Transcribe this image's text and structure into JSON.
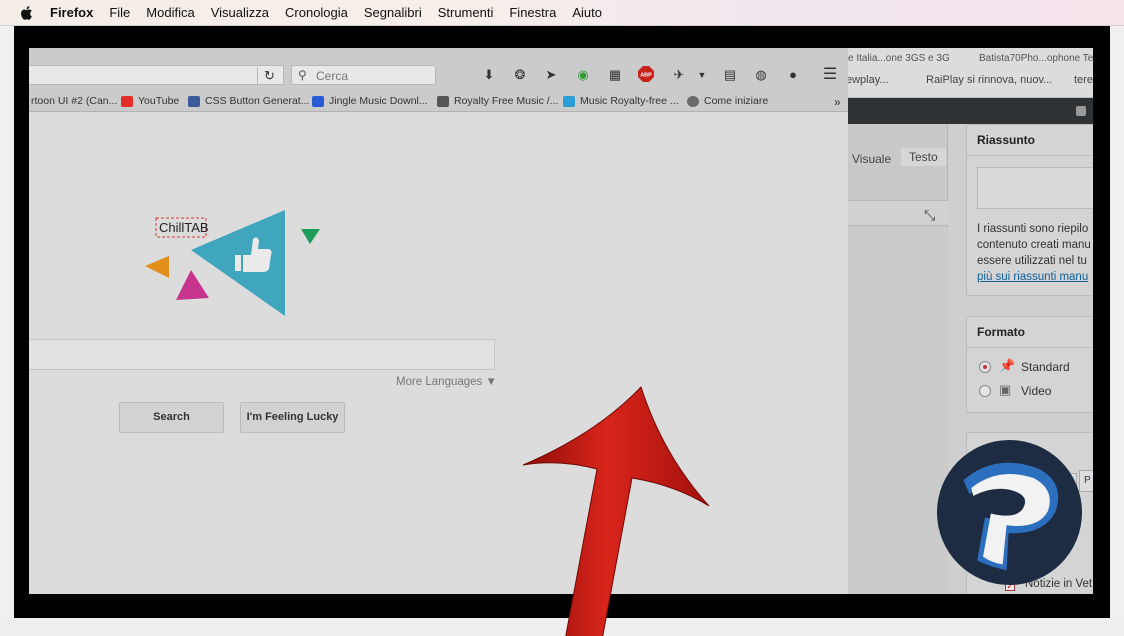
{
  "menubar": {
    "items": [
      "Firefox",
      "File",
      "Modifica",
      "Visualizza",
      "Cronologia",
      "Segnalibri",
      "Strumenti",
      "Finestra",
      "Aiuto"
    ]
  },
  "firefox": {
    "search_placeholder": "Cerca",
    "bookmarks": [
      {
        "label": "rtoon UI #2 (Can...",
        "icon": "generic-page-icon",
        "color": "#9aa0a6"
      },
      {
        "label": "YouTube",
        "icon": "youtube-icon",
        "color": "#e52d27"
      },
      {
        "label": "CSS Button Generat...",
        "icon": "css-icon",
        "color": "#3b5a9a"
      },
      {
        "label": "Jingle Music Downl...",
        "icon": "music-icon",
        "color": "#2a5bd7"
      },
      {
        "label": "Royalty Free Music /...",
        "icon": "royalty-icon",
        "color": "#555555"
      },
      {
        "label": "Music Royalty-free ...",
        "icon": "music-box-icon",
        "color": "#2a9ed7"
      },
      {
        "label": "Come iniziare",
        "icon": "globe-icon",
        "color": "#6a6a6a"
      }
    ],
    "page": {
      "logo_text": "ChillTAB",
      "more_languages": "More Languages ▼",
      "search_button": "Search",
      "lucky_button": "I'm Feeling Lucky"
    }
  },
  "wordpress": {
    "top_tabs": [
      "e Italia...one 3GS e 3G",
      "Batista70Pho...ophone Team"
    ],
    "second_tabs": [
      "ewplay...",
      "RaiPlay si rinnova, nuov...",
      "tere"
    ],
    "editor_tabs": [
      "Visuale",
      "Testo"
    ],
    "summary": {
      "title": "Riassunto",
      "desc_lines": [
        "I riassunti sono riepilo",
        "contenuto creati manu",
        "essere utilizzati nel tu"
      ],
      "link": "più sui riassunti manu"
    },
    "format": {
      "title": "Formato",
      "options": [
        {
          "label": "Standard",
          "selected": true,
          "icon": "pin-icon"
        },
        {
          "label": "Video",
          "selected": false,
          "icon": "video-icon"
        }
      ]
    },
    "category_checkbox": "Notizie in Vet"
  },
  "overlay": {
    "arrow_color": "#c3160f"
  }
}
